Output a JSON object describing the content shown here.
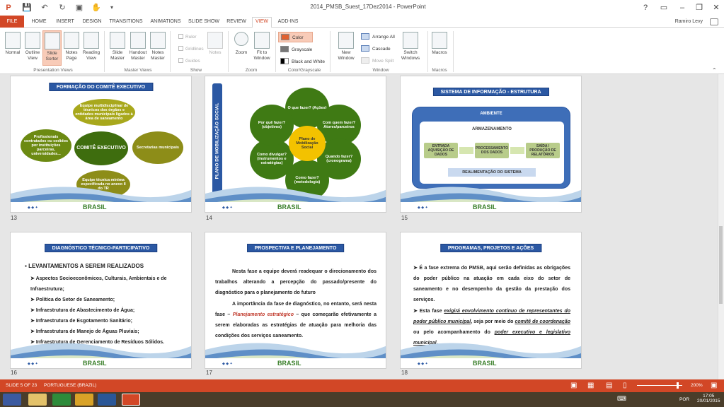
{
  "window": {
    "title": "2014_PMSB_Suest_17Dez2014 - PowerPoint",
    "help": "?",
    "user": "Ramiro Levy"
  },
  "tabs": [
    "FILE",
    "HOME",
    "INSERT",
    "DESIGN",
    "TRANSITIONS",
    "ANIMATIONS",
    "SLIDE SHOW",
    "REVIEW",
    "VIEW",
    "ADD-INS"
  ],
  "ribbon": {
    "presentation_views": {
      "label": "Presentation Views",
      "buttons": [
        "Normal",
        "Outline View",
        "Slide Sorter",
        "Notes Page",
        "Reading View"
      ]
    },
    "master_views": {
      "label": "Master Views",
      "buttons": [
        "Slide Master",
        "Handout Master",
        "Notes Master"
      ]
    },
    "show": {
      "label": "Show",
      "items": [
        "Ruler",
        "Gridlines",
        "Guides"
      ],
      "notes": "Notes"
    },
    "zoom": {
      "label": "Zoom",
      "buttons": [
        "Zoom",
        "Fit to Window"
      ]
    },
    "color": {
      "label": "Color/Grayscale",
      "items": [
        "Color",
        "Grayscale",
        "Black and White"
      ]
    },
    "window": {
      "label": "Window",
      "new_window": "New Window",
      "items": [
        "Arrange All",
        "Cascade",
        "Move Split"
      ],
      "switch": "Switch Windows"
    },
    "macros": {
      "label": "Macros",
      "button": "Macros"
    }
  },
  "slides": [
    {
      "num": "13",
      "title": "FORMAÇÃO DO COMITÊ EXECUTIVO",
      "center": "COMITÊ EXECUTIVO",
      "nodes": [
        "Equipe multidisciplinar de técnicos dos órgãos e entidades municipais ligados à área de saneamento",
        "Profissionais contratados ou cedidos por instituições parceiras, universidades...",
        "Secretarias municipais",
        "Equipe técnica mínima especificada no anexo II do TR"
      ]
    },
    {
      "num": "14",
      "title": "PLANO DE MOBILIZAÇÃO SOCIAL",
      "center": "Plano de Mobilização Social",
      "nodes": [
        "O que fazer? (Ações)",
        "Com quem fazer? Atores/parceiros",
        "Quando fazer? (cronograma)",
        "Como fazer? (metodologia)",
        "Como divulgar? (instrumentos e estratégias)",
        "Por quê fazer? (objetivos)"
      ]
    },
    {
      "num": "15",
      "title": "SISTEMA DE INFORMAÇÃO - ESTRUTURA",
      "ambiente": "AMBIENTE",
      "armazenamento": "ARMAZENAMENTO",
      "boxes": [
        "ENTRADA AQUISIÇÃO DE DADOS",
        "PROCESSAMENTO DOS DADOS",
        "SAÍDA / PRODUÇÃO DE RELATÓRIOS"
      ],
      "feedback": "REALIMENTAÇÃO DO SISTEMA"
    },
    {
      "num": "16",
      "title": "DIAGNÓSTICO TÉCNICO-PARTICIPATIVO",
      "heading": "LEVANTAMENTOS A SEREM REALIZADOS",
      "items": [
        "Aspectos Socioeconômicos, Culturais, Ambientais e de Infraestrutura;",
        "Política do Setor de Saneamento;",
        "Infraestrutura de Abastecimento de Água;",
        "Infraestrutura de Esgotamento Sanitário;",
        "Infraestrutura de Manejo de Águas Pluviais;",
        "Infraestrutura de Gerenciamento de Resíduos Sólidos."
      ]
    },
    {
      "num": "17",
      "title": "PROSPECTIVA E PLANEJAMENTO",
      "p1": "Nesta fase a equipe deverá readequar o direcionamento dos trabalhos alterando a percepção do passado/presente do diagnóstico para o planejamento do futuro",
      "p2a": "A importância da fase de diagnóstico, no entanto, será nesta fase –",
      "p2em": "Planejamento estratégico",
      "p2b": "– que começarão efetivamente a serem elaboradas as estratégias de atuação para melhoria das condições dos serviços saneamento."
    },
    {
      "num": "18",
      "title": "PROGRAMAS, PROJETOS E AÇÕES",
      "b1": "É a fase extrema do PMSB, aqui serão definidas as obrigações do poder público na atuação em cada eixo do setor de saneamento e no desempenho da gestão da prestação dos serviços.",
      "b2a": "Esta fase",
      "b2em1": "exigirá envolvimento contínuo de representantes do poder público municipal",
      "b2b": ", seja por meio do",
      "b2em2": "comitê de coordenação",
      "b2c": "ou pelo acompanhamento do",
      "b2em3": "poder executivo e legislativo municipal",
      "b2d": "."
    }
  ],
  "footer": {
    "brasil": "BRASIL"
  },
  "status": {
    "slide": "SLIDE 5 OF 23",
    "language": "PORTUGUESE (BRAZIL)",
    "zoom": "200%"
  },
  "taskbar": {
    "time": "17:05",
    "date": "20/01/2015",
    "lang": "POR"
  }
}
